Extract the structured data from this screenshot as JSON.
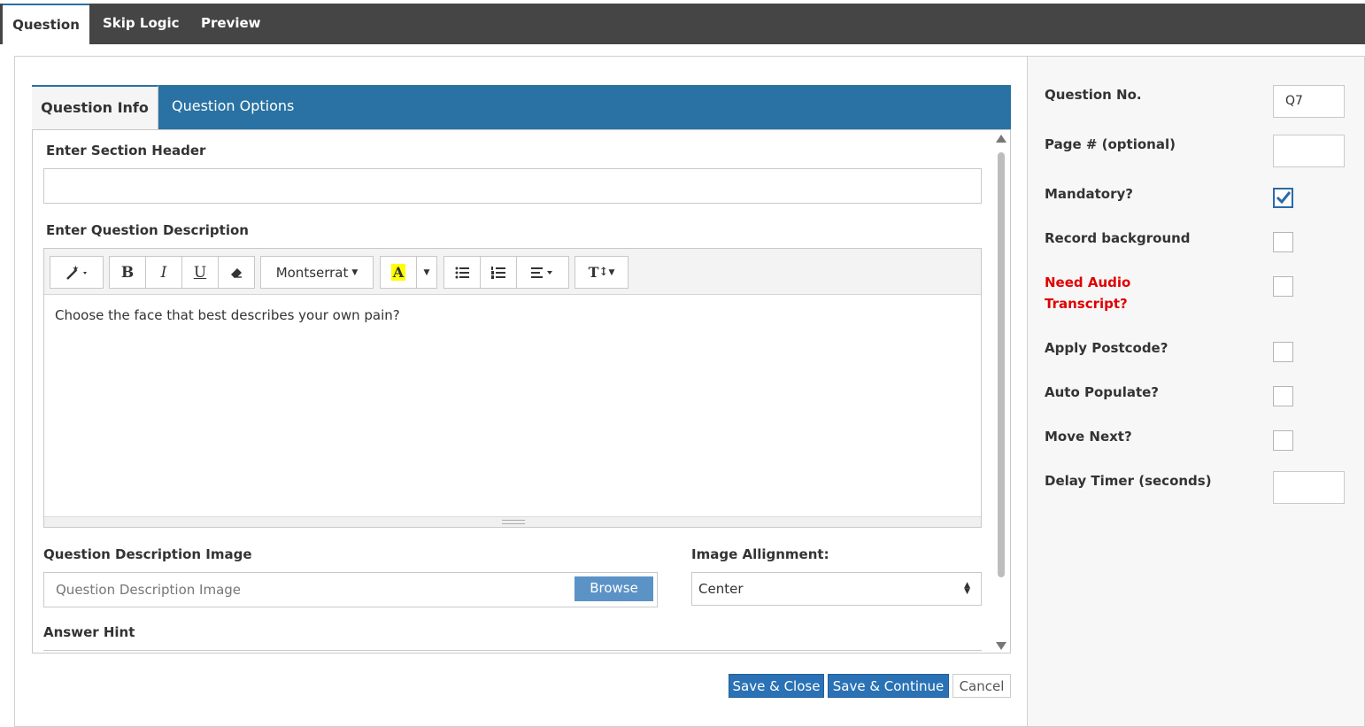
{
  "top_tabs": [
    {
      "label": "Question",
      "active": true
    },
    {
      "label": "Skip Logic",
      "active": false
    },
    {
      "label": "Preview",
      "active": false
    }
  ],
  "inner_tabs": [
    {
      "label": "Question Info",
      "active": true
    },
    {
      "label": "Question Options",
      "active": false
    }
  ],
  "form": {
    "section_header_label": "Enter Section Header",
    "section_header_value": "",
    "question_description_label": "Enter Question Description",
    "editor": {
      "font_name": "Montserrat",
      "content": "Choose the face that best describes your own pain?",
      "toolbar_icons": [
        "magic-wand-icon",
        "bold-icon",
        "italic-icon",
        "underline-icon",
        "eraser-icon",
        "font-family-dropdown",
        "highlight-color-icon",
        "color-dropdown-caret",
        "unordered-list-icon",
        "ordered-list-icon",
        "align-icon",
        "font-size-icon"
      ]
    },
    "description_image_label": "Question Description Image",
    "description_image_placeholder": "Question Description Image",
    "browse_label": "Browse",
    "image_alignment_label": "Image Allignment:",
    "image_alignment_value": "Center",
    "answer_hint_label": "Answer Hint"
  },
  "actions": {
    "save_close": "Save & Close",
    "save_continue": "Save & Continue",
    "cancel": "Cancel"
  },
  "side": {
    "question_no_label": "Question No.",
    "question_no_value": "Q7",
    "page_label": "Page # (optional)",
    "page_value": "",
    "mandatory_label": "Mandatory?",
    "mandatory_checked": true,
    "record_background_label": "Record background",
    "need_audio_line1": "Need Audio",
    "need_audio_line2": "Transcript?",
    "apply_postcode_label": "Apply Postcode?",
    "auto_populate_label": "Auto Populate?",
    "move_next_label": "Move Next?",
    "delay_timer_label": "Delay Timer (seconds)",
    "delay_timer_value": ""
  },
  "colors": {
    "tab_bar": "#454545",
    "accent_blue": "#2a72a3",
    "button_blue": "#2a72b5",
    "required_red": "#e00000"
  }
}
